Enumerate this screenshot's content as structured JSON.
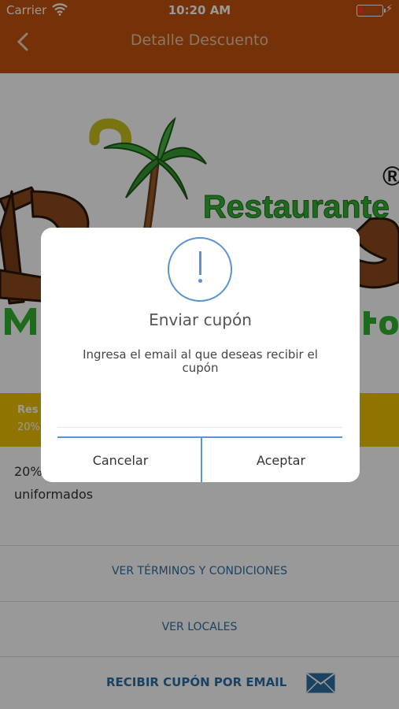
{
  "status": {
    "carrier": "Carrier",
    "time": "10:20 AM",
    "battery_level": 0.18
  },
  "nav": {
    "title": "Detalle Descuento"
  },
  "logo": {
    "brand_text": "Restaurante",
    "registered_mark": "®",
    "colors": {
      "green": "#34b233",
      "brown": "#8a4a1e",
      "palm_yellow": "#c9c21d"
    }
  },
  "promo": {
    "title": "Res",
    "subtitle": "20%"
  },
  "description": "20%\nuniformados",
  "links": {
    "terms": "VER TÉRMINOS Y CONDICIONES",
    "locations": "VER LOCALES",
    "email_coupon": "RECIBIR CUPÓN POR EMAIL"
  },
  "dialog": {
    "title": "Enviar cupón",
    "message": "Ingresa el email al que deseas recibir el cupón",
    "email_value": "",
    "cancel_label": "Cancelar",
    "accept_label": "Aceptar"
  },
  "colors": {
    "header": "#c4520c",
    "accent_blue": "#5a93cf",
    "link_blue": "#2f6fa4",
    "promo_yellow": "#f0c200",
    "overlay": "rgba(0,0,0,0.40)"
  }
}
